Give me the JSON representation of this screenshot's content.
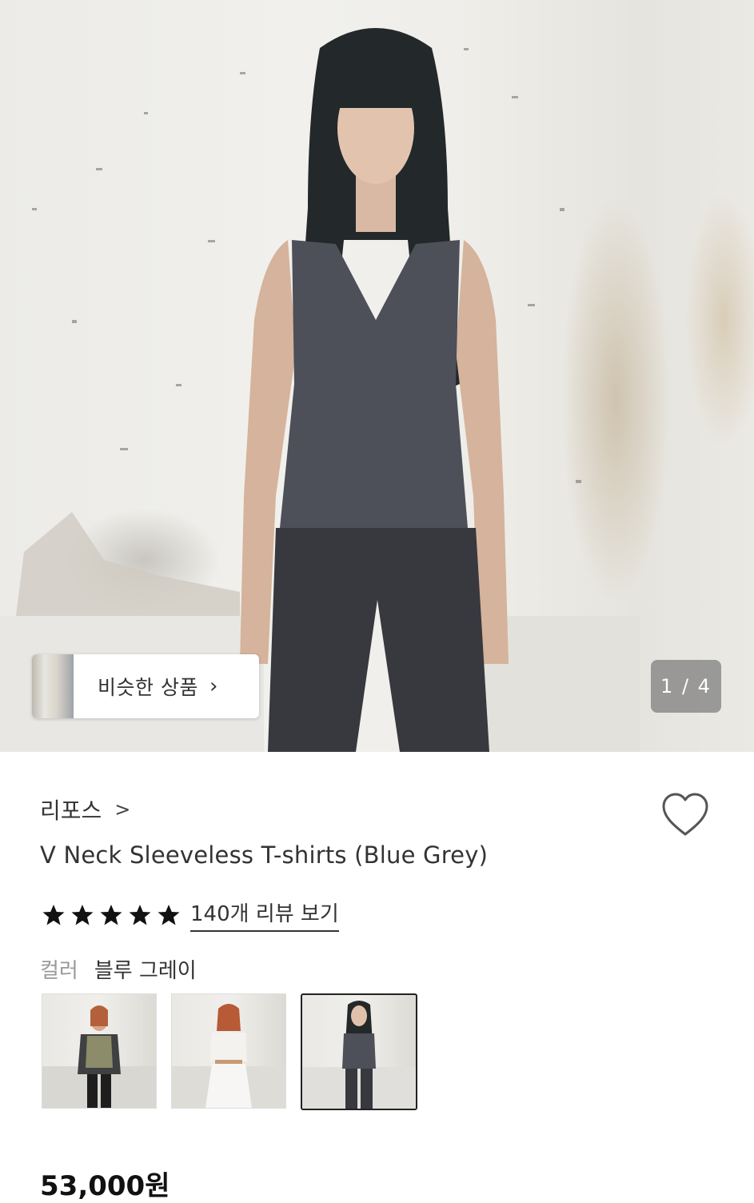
{
  "carousel": {
    "similar_label": "비슷한 상품",
    "similar_chevron": "›",
    "page_indicator": "1 / 4",
    "current_index": 1,
    "total": 4
  },
  "product": {
    "brand": "리포스",
    "brand_chevron": ">",
    "title": "V Neck Sleeveless T-shirts (Blue Grey)",
    "rating": 5,
    "review_link": "140개 리뷰 보기",
    "color_label": "컬러",
    "color_value": "블루 그레이",
    "price": "53,000원",
    "swatches": [
      {
        "name": "olive-vest-set",
        "selected": false
      },
      {
        "name": "white-tee-set",
        "selected": false
      },
      {
        "name": "blue-grey",
        "selected": true
      }
    ]
  },
  "icons": {
    "wishlist": "heart-outline-icon",
    "star": "star-filled-icon"
  },
  "colors": {
    "text_primary": "#333333",
    "text_muted": "#999999",
    "price": "#111111"
  }
}
